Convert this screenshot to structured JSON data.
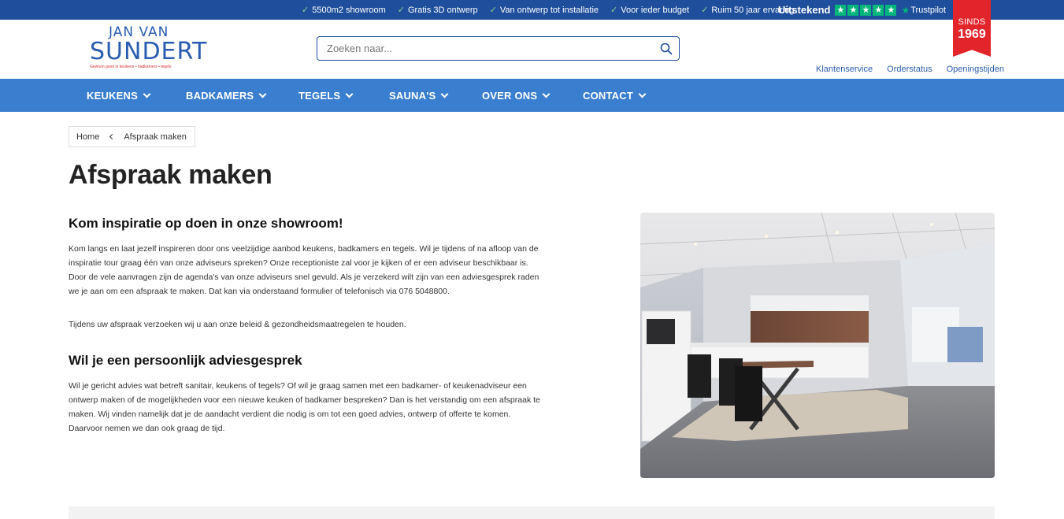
{
  "topbar": {
    "usps": [
      "5500m2 showroom",
      "Gratis 3D ontwerp",
      "Van ontwerp tot installatie",
      "Voor ieder budget",
      "Ruim 50 jaar ervaring"
    ],
    "rating_label": "Uitstekend",
    "trustpilot": "Trustpilot",
    "stars": 5
  },
  "ribbon": {
    "since": "SINDS",
    "year": "1969"
  },
  "logo": {
    "line1": "JAN VAN",
    "line2": "SUNDERT",
    "tagline": "Gewoon goed in keukens • badkamers • tegels"
  },
  "search": {
    "placeholder": "Zoeken naar..."
  },
  "toplinks": [
    "Klantenservice",
    "Orderstatus",
    "Openingstijden"
  ],
  "nav": [
    "KEUKENS",
    "BADKAMERS",
    "TEGELS",
    "SAUNA'S",
    "OVER ONS",
    "CONTACT"
  ],
  "breadcrumb": {
    "home": "Home",
    "current": "Afspraak maken"
  },
  "page": {
    "title": "Afspraak maken",
    "section1": {
      "heading": "Kom inspiratie op doen in onze showroom!",
      "p1": "Kom langs en laat jezelf inspireren door ons veelzijdige aanbod keukens, badkamers en tegels. Wil je tijdens of na afloop van de inspiratie tour graag één van onze adviseurs spreken? Onze receptioniste zal voor je kijken of er een adviseur beschikbaar is. Door de vele aanvragen zijn de agenda's van onze adviseurs snel gevuld. Als je verzekerd wilt zijn van een adviesgesprek raden we je aan om een afspraak te maken. Dat kan via onderstaand formulier of telefonisch via 076 5048800.",
      "p2": "Tijdens uw afspraak verzoeken wij u aan onze beleid & gezondheidsmaatregelen te houden."
    },
    "section2": {
      "heading": "Wil je een persoonlijk adviesgesprek",
      "p1": "Wil je gericht advies wat betreft sanitair, keukens of tegels? Of wil je graag samen met een badkamer- of keukenadviseur een ontwerp maken of de mogelijkheden voor een nieuwe keuken of badkamer bespreken? Dan is het verstandig om een afspraak te maken. Wij vinden namelijk dat je de aandacht verdient die nodig is om tot een goed advies, ontwerp of offerte te komen. Daarvoor nemen we dan ook graag de tijd."
    }
  },
  "colors": {
    "topbar": "#1f4f9c",
    "nav": "#3a7fcf",
    "ribbon": "#e1252b",
    "trustpilot": "#00b67a"
  }
}
